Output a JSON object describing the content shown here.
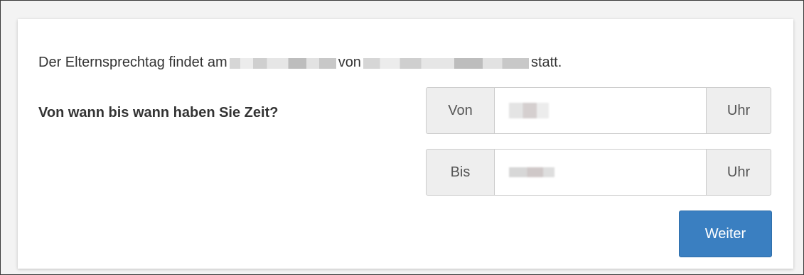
{
  "intro": {
    "prefix": "Der Elternsprechtag findet am",
    "middle": "von",
    "suffix": "statt."
  },
  "question": "Von wann bis wann haben Sie Zeit?",
  "from_group": {
    "prefix": "Von",
    "suffix": "Uhr",
    "value": ""
  },
  "to_group": {
    "prefix": "Bis",
    "suffix": "Uhr",
    "value": ""
  },
  "submit_label": "Weiter",
  "colors": {
    "primary_button": "#3a7fc1",
    "addon_background": "#eeeeee",
    "text": "#333333"
  }
}
